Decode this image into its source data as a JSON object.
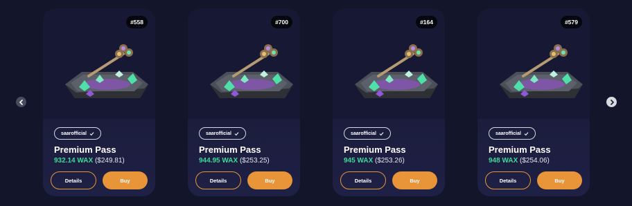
{
  "colors": {
    "background": "#13152b",
    "card": "#1c1d3d",
    "accent": "#e89438",
    "price_green": "#3fd89a"
  },
  "nav": {
    "prev_icon": "chevron-left-icon",
    "next_icon": "chevron-right-icon"
  },
  "cards": [
    {
      "badge": "#558",
      "creator": "saarofficial",
      "verified_icon": "check-icon",
      "title": "Premium Pass",
      "price_wax": "932.14 WAX",
      "price_usd": "($249.81)",
      "details_label": "Details",
      "buy_label": "Buy"
    },
    {
      "badge": "#700",
      "creator": "saarofficial",
      "verified_icon": "check-icon",
      "title": "Premium Pass",
      "price_wax": "944.95 WAX",
      "price_usd": "($253.25)",
      "details_label": "Details",
      "buy_label": "Buy"
    },
    {
      "badge": "#164",
      "creator": "saarofficial",
      "verified_icon": "check-icon",
      "title": "Premium Pass",
      "price_wax": "945 WAX",
      "price_usd": "($253.26)",
      "details_label": "Details",
      "buy_label": "Buy"
    },
    {
      "badge": "#579",
      "creator": "saarofficial",
      "verified_icon": "check-icon",
      "title": "Premium Pass",
      "price_wax": "948 WAX",
      "price_usd": "($254.06)",
      "details_label": "Details",
      "buy_label": "Buy"
    }
  ]
}
